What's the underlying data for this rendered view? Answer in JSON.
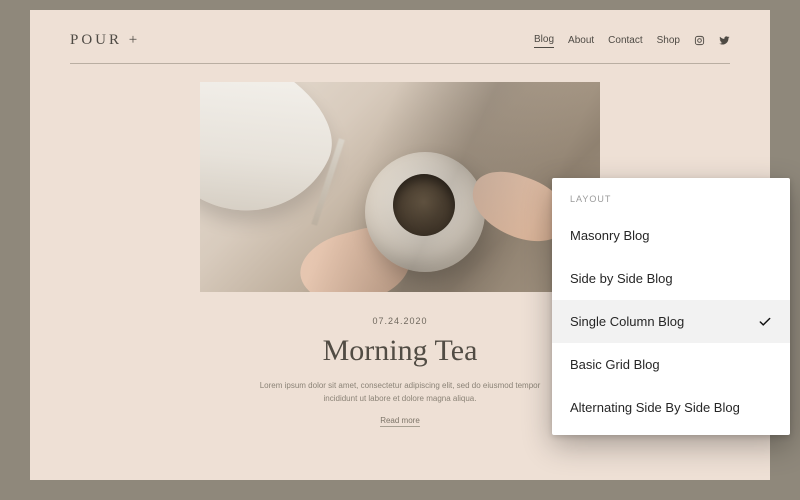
{
  "site": {
    "logo": "POUR +",
    "nav": {
      "blog": "Blog",
      "about": "About",
      "contact": "Contact",
      "shop": "Shop"
    }
  },
  "post": {
    "date": "07.24.2020",
    "title": "Morning Tea",
    "excerpt_line1": "Lorem ipsum dolor sit amet, consectetur adipiscing elit, sed do eiusmod tempor",
    "excerpt_line2": "incididunt ut labore et dolore magna aliqua.",
    "read_more": "Read more"
  },
  "panel": {
    "heading": "LAYOUT",
    "options": {
      "0": "Masonry Blog",
      "1": "Side by Side Blog",
      "2": "Single Column Blog",
      "3": "Basic Grid Blog",
      "4": "Alternating Side By Side Blog"
    },
    "selected_index": 2
  }
}
